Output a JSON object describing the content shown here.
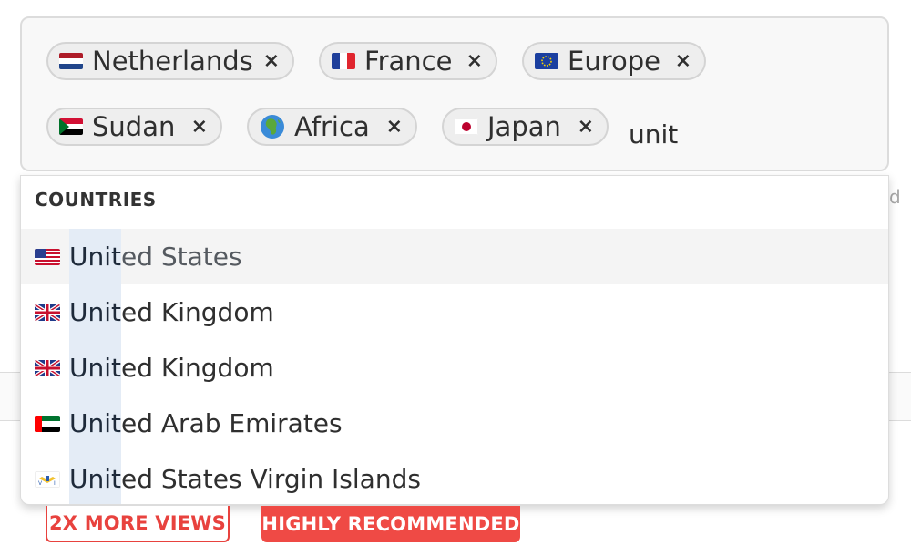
{
  "tags": [
    {
      "label": "Netherlands",
      "flag": "netherlands-flag-icon"
    },
    {
      "label": "France",
      "flag": "france-flag-icon"
    },
    {
      "label": "Europe",
      "flag": "eu-flag-icon"
    },
    {
      "label": "Sudan",
      "flag": "sudan-flag-icon"
    },
    {
      "label": "Africa",
      "flag": "globe-africa-icon"
    },
    {
      "label": "Japan",
      "flag": "japan-flag-icon"
    }
  ],
  "remove_symbol": "×",
  "search": {
    "value": "unit"
  },
  "dropdown": {
    "heading": "COUNTRIES",
    "options": [
      {
        "match": "Unit",
        "rest": "ed States",
        "flag": "us-flag-icon"
      },
      {
        "match": "Unit",
        "rest": "ed Kingdom",
        "flag": "uk-flag-icon"
      },
      {
        "match": "Unit",
        "rest": "ed Kingdom",
        "flag": "uk-flag-icon"
      },
      {
        "match": "Unit",
        "rest": "ed Arab Emirates",
        "flag": "uae-flag-icon"
      },
      {
        "match": "Unit",
        "rest": "ed States Virgin Islands",
        "flag": "usvi-flag-icon"
      }
    ]
  },
  "badges": {
    "views": "2X MORE VIEWS",
    "recommended": "HIGHLY RECOMMENDED"
  },
  "colors": {
    "accent_red": "#ef4a45",
    "highlight": "#e4ecf6"
  }
}
